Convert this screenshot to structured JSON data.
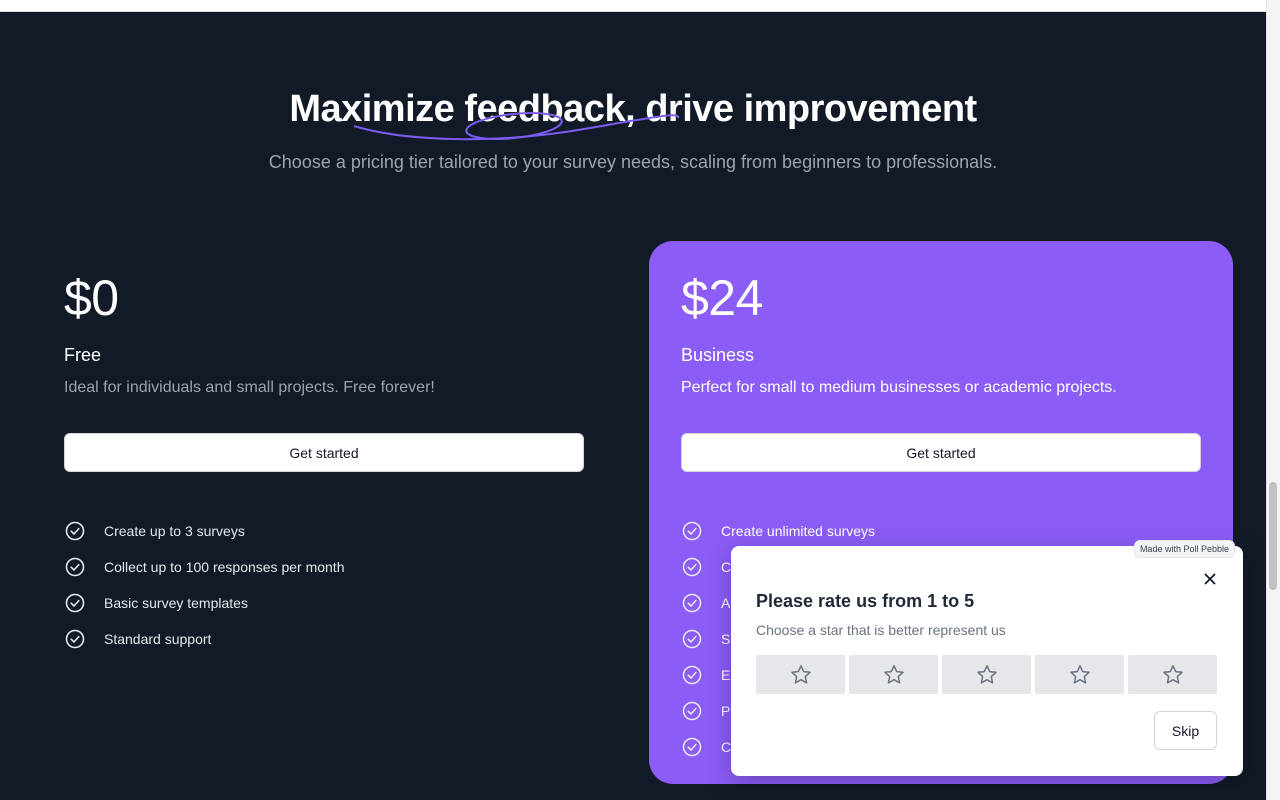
{
  "hero": {
    "title": "Maximize feedback, drive improvement",
    "subtitle": "Choose a pricing tier tailored to your survey needs, scaling from beginners to professionals."
  },
  "colors": {
    "background": "#121a28",
    "accent": "#8b5cf6",
    "swash": "#7c5cf0"
  },
  "plans": [
    {
      "price": "$0",
      "name": "Free",
      "description": "Ideal for individuals and small projects. Free forever!",
      "cta": "Get started",
      "features": [
        "Create up to 3 surveys",
        "Collect up to 100 responses per month",
        "Basic survey templates",
        "Standard support"
      ]
    },
    {
      "price": "$24",
      "name": "Business",
      "description": "Perfect for small to medium businesses or academic projects.",
      "cta": "Get started",
      "features": [
        "Create unlimited surveys",
        "C",
        "A",
        "S",
        "E",
        "P",
        "C"
      ]
    }
  ],
  "icons": {
    "feature": "check-circle-icon",
    "close": "close-icon",
    "rating": "star-outline-icon"
  },
  "survey": {
    "branding": "Made with Poll Pebble",
    "title": "Please rate us from 1 to 5",
    "subtitle": "Choose a star that is better represent us",
    "rating_max": 5,
    "skip_label": "Skip"
  }
}
